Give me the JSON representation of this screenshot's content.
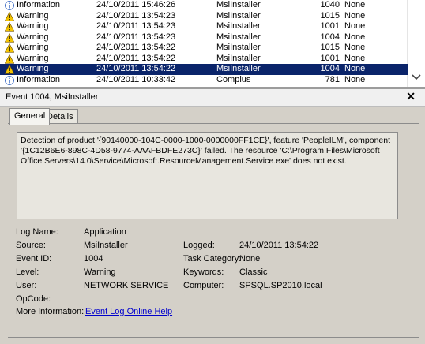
{
  "event_list": {
    "rows": [
      {
        "level": "Information",
        "icon": "info-icon",
        "datetime": "24/10/2011 15:46:26",
        "source": "MsiInstaller",
        "event_id": "1040",
        "task": "None",
        "selected": false
      },
      {
        "level": "Warning",
        "icon": "warning-icon",
        "datetime": "24/10/2011 13:54:23",
        "source": "MsiInstaller",
        "event_id": "1015",
        "task": "None",
        "selected": false
      },
      {
        "level": "Warning",
        "icon": "warning-icon",
        "datetime": "24/10/2011 13:54:23",
        "source": "MsiInstaller",
        "event_id": "1001",
        "task": "None",
        "selected": false
      },
      {
        "level": "Warning",
        "icon": "warning-icon",
        "datetime": "24/10/2011 13:54:23",
        "source": "MsiInstaller",
        "event_id": "1004",
        "task": "None",
        "selected": false
      },
      {
        "level": "Warning",
        "icon": "warning-icon",
        "datetime": "24/10/2011 13:54:22",
        "source": "MsiInstaller",
        "event_id": "1015",
        "task": "None",
        "selected": false
      },
      {
        "level": "Warning",
        "icon": "warning-icon",
        "datetime": "24/10/2011 13:54:22",
        "source": "MsiInstaller",
        "event_id": "1001",
        "task": "None",
        "selected": false
      },
      {
        "level": "Warning",
        "icon": "warning-icon",
        "datetime": "24/10/2011 13:54:22",
        "source": "MsiInstaller",
        "event_id": "1004",
        "task": "None",
        "selected": true
      },
      {
        "level": "Information",
        "icon": "info-icon",
        "datetime": "24/10/2011 10:33:42",
        "source": "Complus",
        "event_id": "781",
        "task": "None",
        "selected": false
      }
    ]
  },
  "detail": {
    "header_title": "Event 1004, MsiInstaller",
    "close_glyph": "✕",
    "tabs": {
      "general": "General",
      "details": "Details"
    },
    "description": "Detection of product '{90140000-104C-0000-1000-0000000FF1CE}', feature 'PeopleILM', component '{1C12B6E6-898C-4D58-9774-AAAFBDFE273C}' failed.  The resource 'C:\\Program Files\\Microsoft Office Servers\\14.0\\Service\\Microsoft.ResourceManagement.Service.exe' does not exist.",
    "fields": {
      "log_name_label": "Log Name:",
      "log_name": "Application",
      "source_label": "Source:",
      "source": "MsiInstaller",
      "logged_label": "Logged:",
      "logged": "24/10/2011 13:54:22",
      "event_id_label": "Event ID:",
      "event_id": "1004",
      "task_category_label": "Task Category:",
      "task_category": "None",
      "level_label": "Level:",
      "level": "Warning",
      "keywords_label": "Keywords:",
      "keywords": "Classic",
      "user_label": "User:",
      "user": "NETWORK SERVICE",
      "computer_label": "Computer:",
      "computer": "SPSQL.SP2010.local",
      "opcode_label": "OpCode:",
      "opcode": "",
      "more_info_label": "More Information:",
      "more_info_link": "Event Log Online Help"
    }
  },
  "colors": {
    "selection": "#0a246a",
    "warning": "#f4c400",
    "info": "#2d5fbf"
  }
}
